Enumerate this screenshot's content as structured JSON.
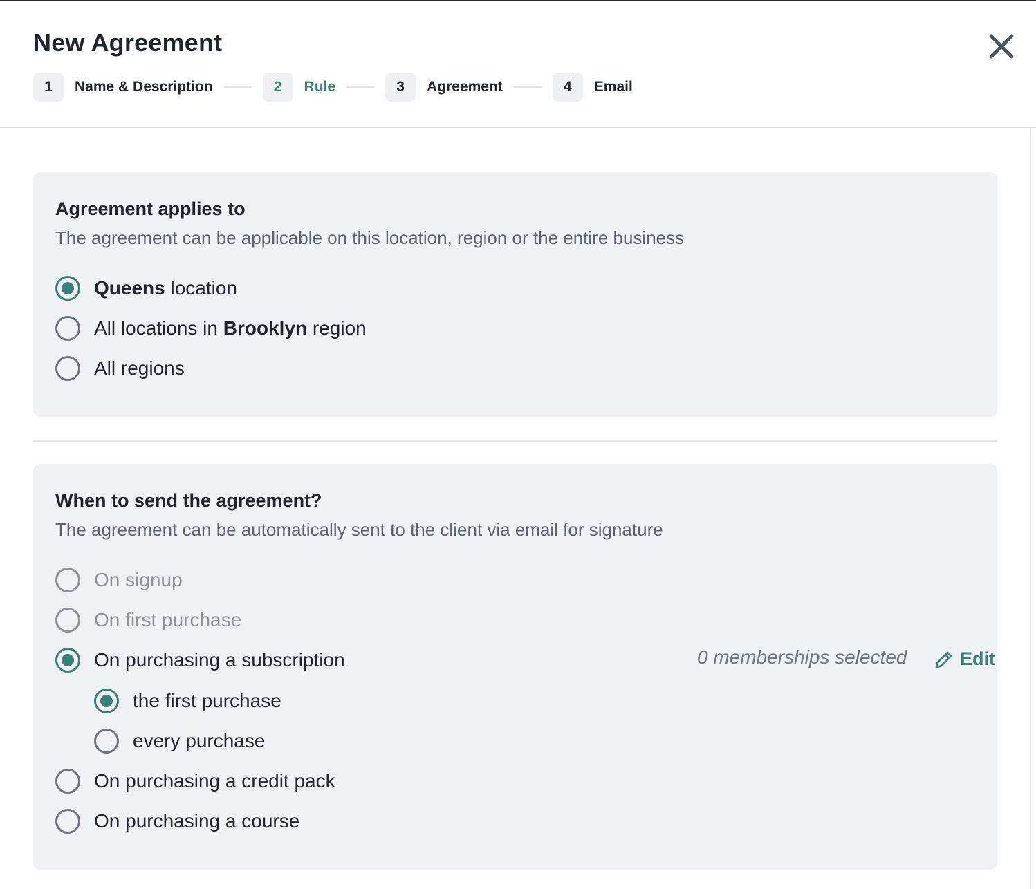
{
  "modal": {
    "title": "New Agreement",
    "close_icon": "close-icon"
  },
  "stepper": {
    "steps": [
      {
        "number": "1",
        "label": "Name & Description",
        "active": false
      },
      {
        "number": "2",
        "label": "Rule",
        "active": true
      },
      {
        "number": "3",
        "label": "Agreement",
        "active": false
      },
      {
        "number": "4",
        "label": "Email",
        "active": false
      }
    ]
  },
  "applies_to": {
    "title": "Agreement applies to",
    "description": "The agreement can be applicable on this location, region or the entire business",
    "options": [
      {
        "bold": "Queens",
        "after": " location",
        "checked": true
      },
      {
        "before": "All locations in ",
        "bold": "Brooklyn",
        "after": " region",
        "checked": false
      },
      {
        "text": "All regions",
        "checked": false
      }
    ]
  },
  "when_to_send": {
    "title": "When to send the agreement?",
    "description": "The agreement can be automatically sent to the client via email for signature",
    "options": [
      {
        "label": "On signup",
        "checked": false,
        "disabled": true
      },
      {
        "label": "On first purchase",
        "checked": false,
        "disabled": true
      },
      {
        "label": "On purchasing a subscription",
        "checked": true,
        "disabled": false
      },
      {
        "label": "On purchasing a credit pack",
        "checked": false,
        "disabled": false
      },
      {
        "label": "On purchasing a course",
        "checked": false,
        "disabled": false
      }
    ],
    "sub_options": [
      {
        "label": "the first purchase",
        "checked": true
      },
      {
        "label": "every purchase",
        "checked": false
      }
    ],
    "memberships_selected": "0 memberships selected",
    "edit_label": "Edit"
  },
  "colors": {
    "accent": "#3a7f7a",
    "card_bg": "#eff1f4",
    "text": "#1e2530",
    "muted": "#5a6473"
  }
}
